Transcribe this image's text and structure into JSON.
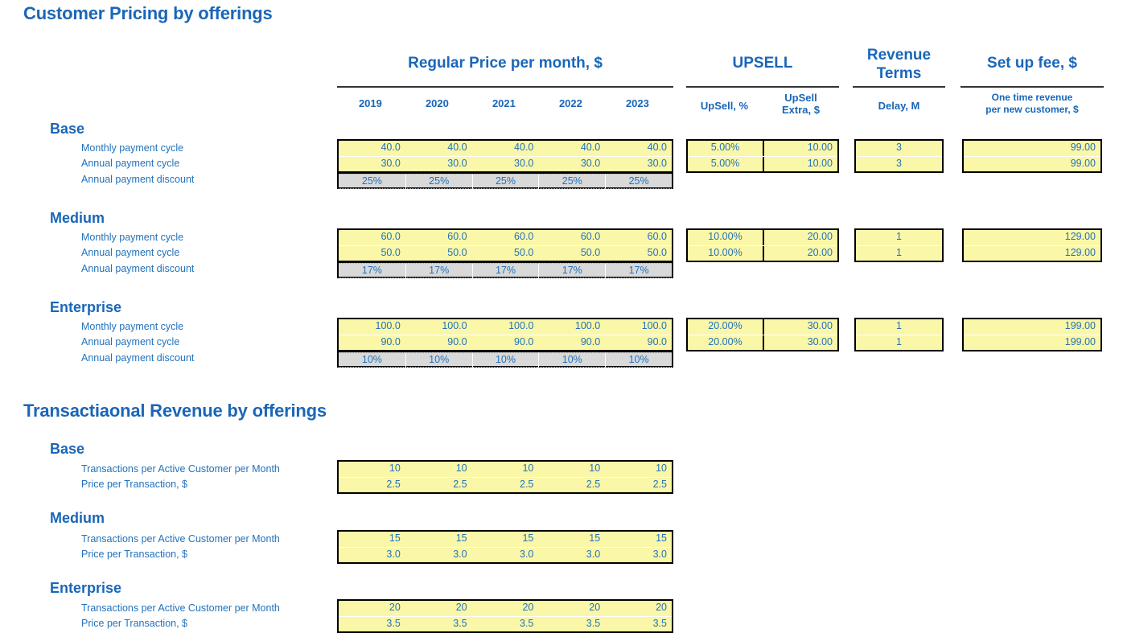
{
  "sections": {
    "pricing_title": "Customer Pricing by offerings",
    "transactional_title": "Transactiaonal Revenue by offerings"
  },
  "column_headers": {
    "regular_price": "Regular Price per month, $",
    "upsell": "UPSELL",
    "revenue_terms_line1": "Revenue",
    "revenue_terms_line2": "Terms",
    "setup_fee": "Set up fee, $",
    "years": [
      "2019",
      "2020",
      "2021",
      "2022",
      "2023"
    ],
    "upsell_pct": "UpSell, %",
    "upsell_extra_line1": "UpSell",
    "upsell_extra_line2": "Extra, $",
    "delay": "Delay, M",
    "one_time_line1": "One time revenue",
    "one_time_line2": "per new customer, $"
  },
  "row_labels": {
    "monthly": "Monthly payment cycle",
    "annual": "Annual payment cycle",
    "discount": "Annual payment discount",
    "transactions": "Transactions per Active Customer per Month",
    "price_per_transaction": "Price per Transaction, $"
  },
  "tiers": {
    "base": "Base",
    "medium": "Medium",
    "enterprise": "Enterprise"
  },
  "pricing": {
    "base": {
      "monthly": [
        "40.0",
        "40.0",
        "40.0",
        "40.0",
        "40.0"
      ],
      "annual": [
        "30.0",
        "30.0",
        "30.0",
        "30.0",
        "30.0"
      ],
      "discount": [
        "25%",
        "25%",
        "25%",
        "25%",
        "25%"
      ],
      "upsell_pct": [
        "5.00%",
        "5.00%"
      ],
      "upsell_extra": [
        "10.00",
        "10.00"
      ],
      "delay": [
        "3",
        "3"
      ],
      "setup_fee": [
        "99.00",
        "99.00"
      ]
    },
    "medium": {
      "monthly": [
        "60.0",
        "60.0",
        "60.0",
        "60.0",
        "60.0"
      ],
      "annual": [
        "50.0",
        "50.0",
        "50.0",
        "50.0",
        "50.0"
      ],
      "discount": [
        "17%",
        "17%",
        "17%",
        "17%",
        "17%"
      ],
      "upsell_pct": [
        "10.00%",
        "10.00%"
      ],
      "upsell_extra": [
        "20.00",
        "20.00"
      ],
      "delay": [
        "1",
        "1"
      ],
      "setup_fee": [
        "129.00",
        "129.00"
      ]
    },
    "enterprise": {
      "monthly": [
        "100.0",
        "100.0",
        "100.0",
        "100.0",
        "100.0"
      ],
      "annual": [
        "90.0",
        "90.0",
        "90.0",
        "90.0",
        "90.0"
      ],
      "discount": [
        "10%",
        "10%",
        "10%",
        "10%",
        "10%"
      ],
      "upsell_pct": [
        "20.00%",
        "20.00%"
      ],
      "upsell_extra": [
        "30.00",
        "30.00"
      ],
      "delay": [
        "1",
        "1"
      ],
      "setup_fee": [
        "199.00",
        "199.00"
      ]
    }
  },
  "transactional": {
    "base": {
      "transactions": [
        "10",
        "10",
        "10",
        "10",
        "10"
      ],
      "price": [
        "2.5",
        "2.5",
        "2.5",
        "2.5",
        "2.5"
      ]
    },
    "medium": {
      "transactions": [
        "15",
        "15",
        "15",
        "15",
        "15"
      ],
      "price": [
        "3.0",
        "3.0",
        "3.0",
        "3.0",
        "3.0"
      ]
    },
    "enterprise": {
      "transactions": [
        "20",
        "20",
        "20",
        "20",
        "20"
      ],
      "price": [
        "3.5",
        "3.5",
        "3.5",
        "3.5",
        "3.5"
      ]
    }
  },
  "colors": {
    "heading_blue": "#1A66B8",
    "data_blue": "#2272BC",
    "input_yellow": "#FAF7A8",
    "calc_gray": "#D9D9D9",
    "border_black": "#000000"
  }
}
